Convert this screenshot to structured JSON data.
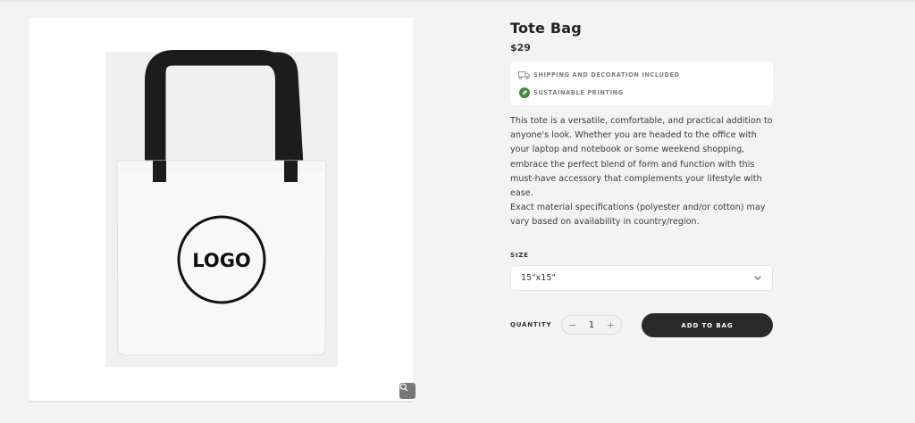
{
  "product": {
    "title": "Tote Bag",
    "price": "$29",
    "image_logo_text": "LOGO",
    "features": [
      {
        "icon": "truck-icon",
        "label": "SHIPPING AND DECORATION INCLUDED"
      },
      {
        "icon": "leaf-icon",
        "label": "SUSTAINABLE PRINTING"
      }
    ],
    "description": [
      "This tote is a versatile, comfortable, and practical addition to anyone's look. Whether you are headed to the office with your laptop and notebook or some weekend shopping, embrace the perfect blend of form and function with this must-have accessory that complements your lifestyle with ease.",
      "Exact material specifications (polyester and/or cotton) may vary based on availability in country/region."
    ]
  },
  "size": {
    "label": "SIZE",
    "selected": "15\"x15\""
  },
  "quantity": {
    "label": "QUANTITY",
    "decrement": "−",
    "value": "1",
    "increment": "+"
  },
  "cart": {
    "add_label": "ADD TO BAG"
  },
  "colors": {
    "button": "#2a2a2a",
    "leaf_badge": "#3d8b3d",
    "background": "#f3f3f3"
  }
}
